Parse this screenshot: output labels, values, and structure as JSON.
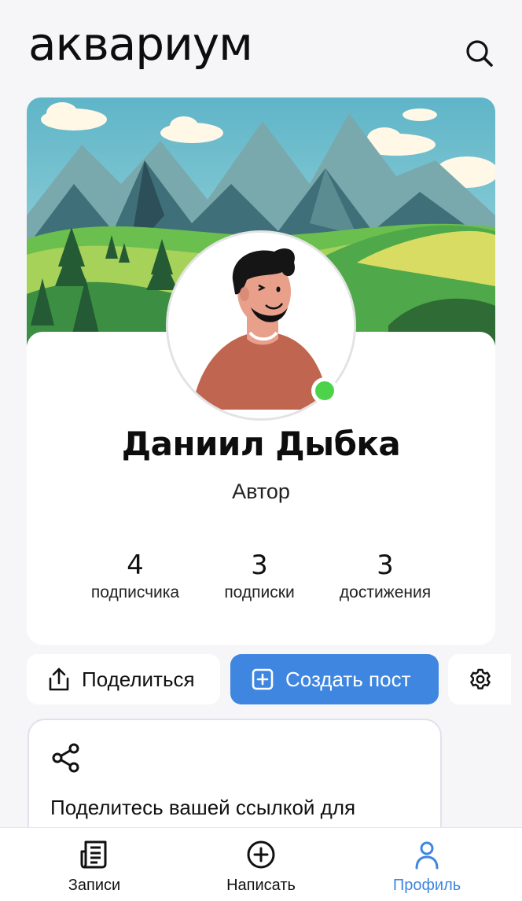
{
  "header": {
    "logo": "аквариум",
    "search_icon": "search-icon"
  },
  "profile": {
    "name": "Даниил Дыбка",
    "role": "Автор",
    "online": true,
    "stats": [
      {
        "value": "4",
        "label": "подписчика"
      },
      {
        "value": "3",
        "label": "подписки"
      },
      {
        "value": "3",
        "label": "достижения"
      }
    ]
  },
  "actions": {
    "share_label": "Поделиться",
    "create_label": "Создать пост",
    "settings_icon": "gear-icon"
  },
  "share_card": {
    "text": "Поделитесь вашей ссылкой для"
  },
  "bottom_nav": {
    "items": [
      {
        "label": "Записи",
        "icon": "newspaper-icon",
        "active": false
      },
      {
        "label": "Написать",
        "icon": "plus-circle-icon",
        "active": false
      },
      {
        "label": "Профиль",
        "icon": "person-icon",
        "active": true
      }
    ]
  },
  "colors": {
    "accent": "#3f86e1",
    "online": "#4cd34a",
    "background": "#f6f6f8"
  }
}
